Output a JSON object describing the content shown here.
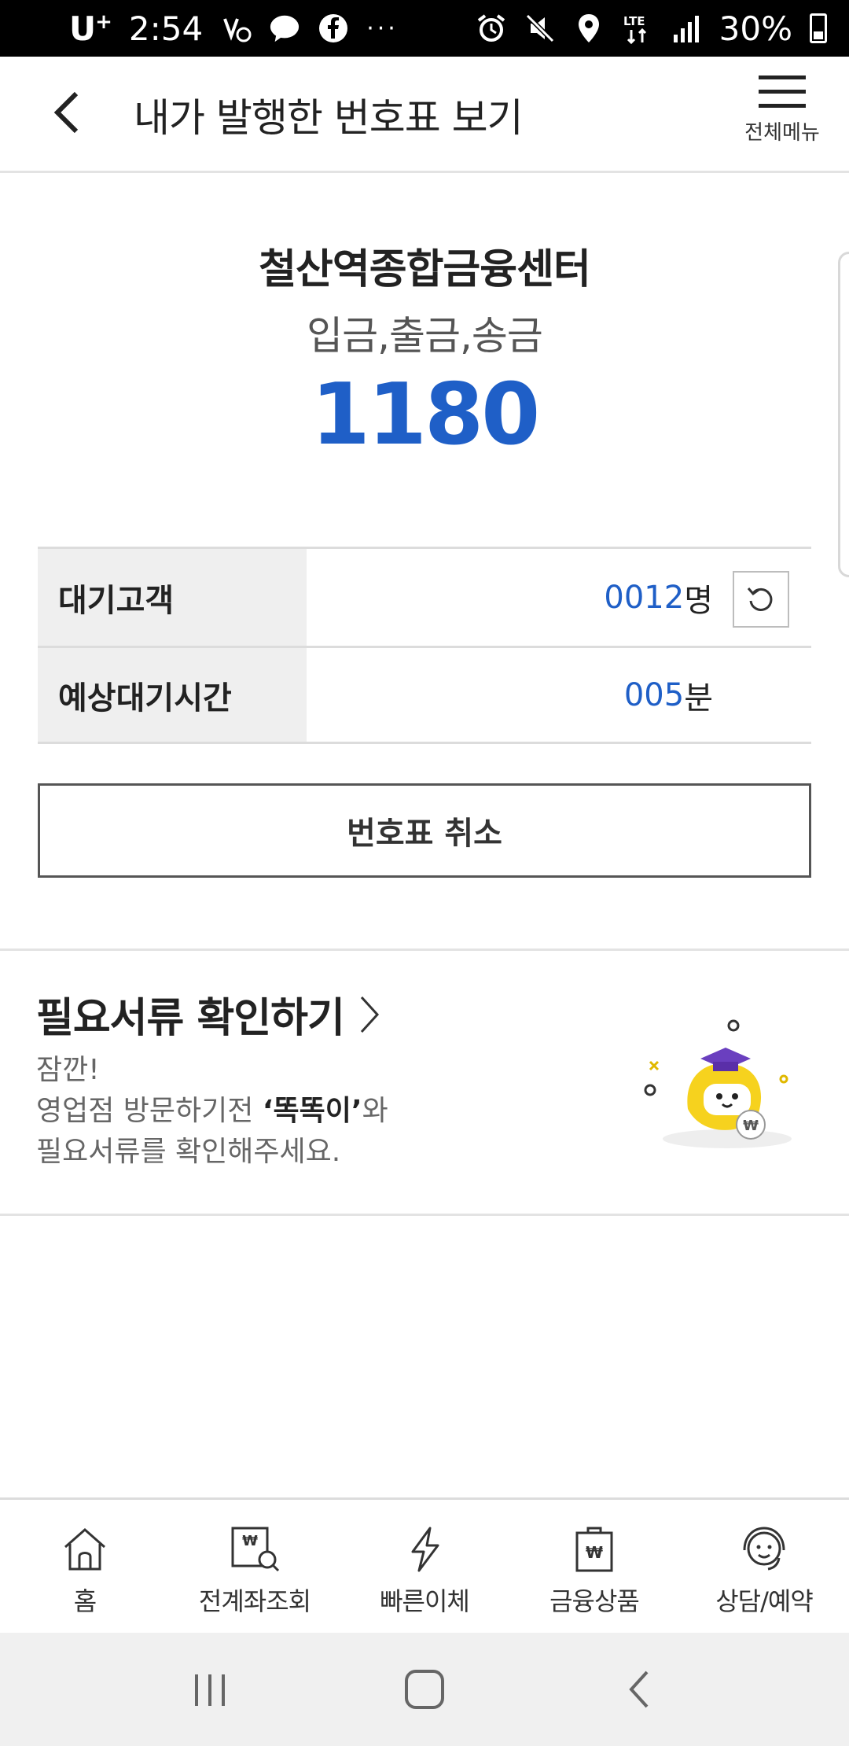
{
  "status_bar": {
    "carrier": "U",
    "carrier_sup": "+",
    "time": "2:54",
    "more": "···",
    "battery_pct": "30%"
  },
  "header": {
    "title": "내가 발행한 번호표 보기",
    "menu_label": "전체메뉴"
  },
  "ticket": {
    "branch": "철산역종합금융센터",
    "service": "입금,출금,송금",
    "number": "1180"
  },
  "info": {
    "waiting_label": "대기고객",
    "waiting_count": "0012",
    "waiting_unit": "명",
    "time_label": "예상대기시간",
    "time_value": "005",
    "time_unit": "분"
  },
  "cancel_label": "번호표 취소",
  "docs": {
    "title": "필요서류 확인하기",
    "line1": "잠깐!",
    "line2_pre": "영업점 방문하기전 ",
    "line2_strong": "‘똑똑이’",
    "line2_post": "와",
    "line3": "필요서류를 확인해주세요."
  },
  "bottom_nav": [
    {
      "label": "홈",
      "icon": "home-icon"
    },
    {
      "label": "전계좌조회",
      "icon": "account-search-icon"
    },
    {
      "label": "빠른이체",
      "icon": "lightning-icon"
    },
    {
      "label": "금융상품",
      "icon": "finance-bag-icon"
    },
    {
      "label": "상담/예약",
      "icon": "headset-icon"
    }
  ],
  "colors": {
    "accent": "#1f5fc7",
    "mascot_yellow": "#f6d21e",
    "mascot_purple": "#6a3fbf"
  }
}
